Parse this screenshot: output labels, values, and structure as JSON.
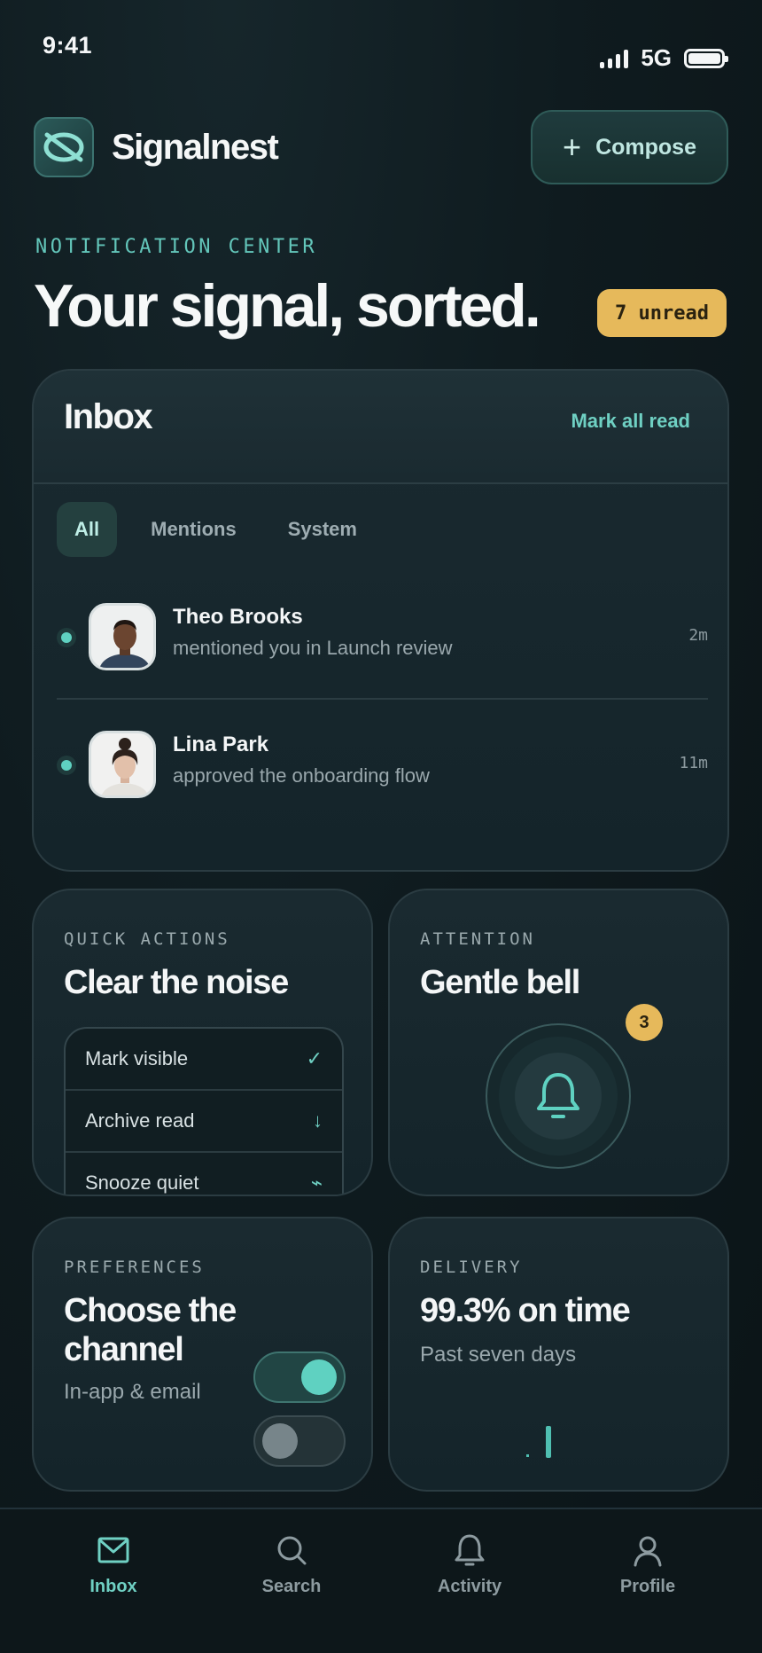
{
  "status": {
    "time": "9:41",
    "network": "5G"
  },
  "brand": {
    "name": "Signalnest"
  },
  "compose": {
    "label": "Compose"
  },
  "hero": {
    "eyebrow": "NOTIFICATION CENTER",
    "headline": "Your signal, sorted.",
    "unread_badge": "7 unread"
  },
  "inbox": {
    "title": "Inbox",
    "mark_all": "Mark all read",
    "tabs": [
      "All",
      "Mentions",
      "System"
    ],
    "active_tab": "All",
    "items": [
      {
        "name": "Theo Brooks",
        "text": "mentioned you in Launch review",
        "time": "2m",
        "unread": true
      },
      {
        "name": "Lina Park",
        "text": "approved the onboarding flow",
        "time": "11m",
        "unread": true
      }
    ]
  },
  "quick_actions": {
    "kicker": "QUICK ACTIONS",
    "title": "Clear the noise",
    "items": [
      {
        "label": "Mark visible",
        "icon": "check-icon"
      },
      {
        "label": "Archive read",
        "icon": "arrow-down-icon"
      },
      {
        "label": "Snooze quiet",
        "icon": "snooze-icon"
      }
    ]
  },
  "attention": {
    "kicker": "ATTENTION",
    "title": "Gentle bell",
    "badge": "3"
  },
  "preferences": {
    "kicker": "PREFERENCES",
    "title": "Choose the channel",
    "subtitle": "In-app & email",
    "toggles": [
      {
        "name": "in-app",
        "on": true
      },
      {
        "name": "email",
        "on": false
      }
    ]
  },
  "delivery": {
    "kicker": "DELIVERY",
    "title": "99.3% on time",
    "subtitle": "Past seven days"
  },
  "tabbar": {
    "items": [
      "Inbox",
      "Search",
      "Activity",
      "Profile"
    ],
    "active": "Inbox"
  },
  "colors": {
    "accent": "#5fd1c1",
    "badge": "#e6b95b",
    "background": "#0f1b1f"
  }
}
